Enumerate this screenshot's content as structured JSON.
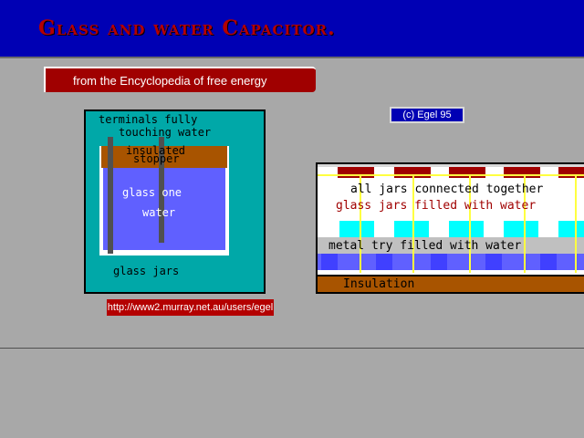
{
  "header": {
    "title": "Glass  and water  Capacitor."
  },
  "source_banner": {
    "text": "from  the Encyclopedia of free energy"
  },
  "copyright": {
    "text": "(c)  Egel  95"
  },
  "url": {
    "text": "http://www2.murray.net.au/users/egel"
  },
  "left_diagram": {
    "label_terminals": "terminals fully",
    "label_touching": "touching water",
    "label_insulated": "insulated",
    "label_stopper": "stopper",
    "label_glass_one": "glass one",
    "label_water": "water",
    "label_glass_jars": "glass  jars"
  },
  "right_diagram": {
    "label_all_jars": "all jars connected together",
    "label_filled": "glass jars filled with water",
    "label_tray": "metal try filled with water",
    "label_insulation": "Insulation"
  },
  "colors": {
    "header_bg": "#0000b4",
    "title_red": "#b40000",
    "page_bg": "#a8a8a8",
    "water_blue": "#6060ff",
    "teal": "#00a8a8",
    "insulation_brown": "#a85400",
    "terminal_yellow": "#ffff40"
  }
}
